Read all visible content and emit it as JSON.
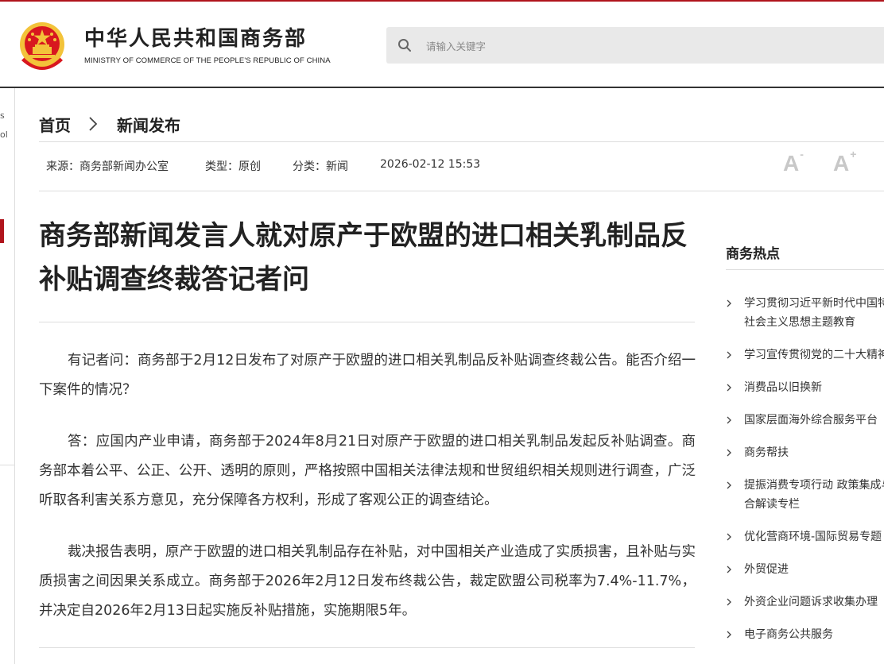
{
  "header": {
    "title": "中华人民共和国商务部",
    "subtitle": "MINISTRY OF COMMERCE OF THE PEOPLE'S REPUBLIC OF CHINA",
    "search_placeholder": "请输入关键字"
  },
  "left_fragment": {
    "text1": "s",
    "text2": "ol"
  },
  "breadcrumb": {
    "home": "首页",
    "section": "新闻发布"
  },
  "meta": {
    "source": "来源：商务部新闻办公室",
    "type": "类型：原创",
    "category": "分类：新闻",
    "datetime": "2026-02-12 15:53"
  },
  "font_controls": {
    "decrease": "A",
    "decrease_mark": "-",
    "increase": "A",
    "increase_mark": "+"
  },
  "article": {
    "title": "商务部新闻发言人就对原产于欧盟的进口相关乳制品反补贴调查终裁答记者问",
    "paragraphs": [
      "有记者问：商务部于2月12日发布了对原产于欧盟的进口相关乳制品反补贴调查终裁公告。能否介绍一下案件的情况？",
      "答：应国内产业申请，商务部于2024年8月21日对原产于欧盟的进口相关乳制品发起反补贴调查。商务部本着公平、公正、公开、透明的原则，严格按照中国相关法律法规和世贸组织相关规则进行调查，广泛听取各利害关系方意见，充分保障各方权利，形成了客观公正的调查结论。",
      "裁决报告表明，原产于欧盟的进口相关乳制品存在补贴，对中国相关产业造成了实质损害，且补贴与实质损害之间因果关系成立。商务部于2026年2月12日发布终裁公告，裁定欧盟公司税率为7.4%-11.7%，并决定自2026年2月13日起实施反补贴措施，实施期限5年。"
    ]
  },
  "sidebar": {
    "title": "商务热点",
    "items": [
      {
        "line1": "学习贯彻习近平新时代中国特色",
        "line2": "社会主义思想主题教育"
      },
      {
        "line1": "学习宣传贯彻党的二十大精神",
        "line2": ""
      },
      {
        "line1": "消费品以旧换新",
        "line2": ""
      },
      {
        "line1": "国家层面海外综合服务平台",
        "line2": ""
      },
      {
        "line1": "商务帮扶",
        "line2": ""
      },
      {
        "line1": "提振消费专项行动 政策集成与综",
        "line2": "合解读专栏"
      },
      {
        "line1": "优化营商环境-国际贸易专题",
        "line2": ""
      },
      {
        "line1": "外贸促进",
        "line2": ""
      },
      {
        "line1": "外资企业问题诉求收集办理",
        "line2": ""
      },
      {
        "line1": "电子商务公共服务",
        "line2": ""
      }
    ]
  },
  "colors": {
    "accent_red": "#b0141c",
    "emblem_gold": "#f3c33a",
    "text": "#333333"
  }
}
